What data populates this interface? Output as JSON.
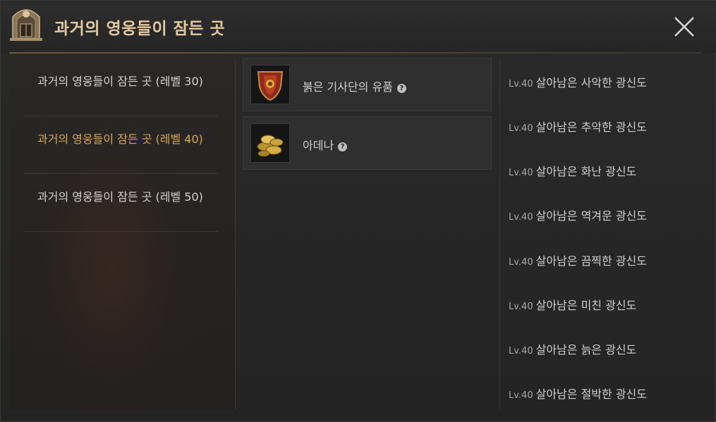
{
  "header": {
    "title": "과거의 영웅들이 잠든 곳"
  },
  "dungeon_list": [
    {
      "label": "과거의 영웅들이 잠든 곳 (레벨 30)",
      "active": false
    },
    {
      "label": "과거의 영웅들이 잠든 곳 (레벨 40)",
      "active": true
    },
    {
      "label": "과거의 영웅들이 잠든 곳 (레벨 50)",
      "active": false
    }
  ],
  "rewards": [
    {
      "name": "붉은 기사단의 유품",
      "icon": "shield-icon"
    },
    {
      "name": "아데나",
      "icon": "coins-icon"
    }
  ],
  "monsters": [
    {
      "level": "Lv.40",
      "name": "살아남은 사악한 광신도"
    },
    {
      "level": "Lv.40",
      "name": "살아남은 추악한 광신도"
    },
    {
      "level": "Lv.40",
      "name": "살아남은 화난 광신도"
    },
    {
      "level": "Lv.40",
      "name": "살아남은 역겨운 광신도"
    },
    {
      "level": "Lv.40",
      "name": "살아남은 끔찍한 광신도"
    },
    {
      "level": "Lv.40",
      "name": "살아남은 미친 광신도"
    },
    {
      "level": "Lv.40",
      "name": "살아남은 늙은 광신도"
    },
    {
      "level": "Lv.40",
      "name": "살아남은 절박한 광신도"
    }
  ],
  "colors": {
    "title": "#e4c9a0",
    "active_item": "#d7a653"
  }
}
